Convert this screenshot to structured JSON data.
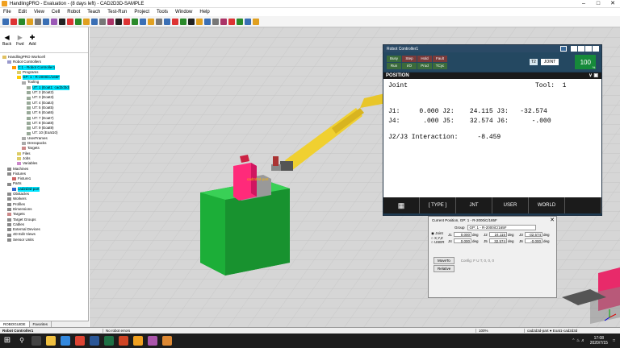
{
  "window": {
    "title": "HandlingPRO - Evaluation - (8 days left) - CAD2D3D-SAMPLE"
  },
  "menu": [
    "File",
    "Edit",
    "View",
    "Cell",
    "Robot",
    "Teach",
    "Test-Run",
    "Project",
    "Tools",
    "Window",
    "Help"
  ],
  "sidebar": {
    "back_label": "Back",
    "fwd_label": "Fwd",
    "add_label": "Add",
    "tree": [
      {
        "label": "HandlingPRO Workcell",
        "level": 0,
        "color": "#e0c060"
      },
      {
        "label": "Robot Controllers",
        "level": 1,
        "color": "#9999cc"
      },
      {
        "label": "C:1 - Robot Controller1",
        "level": 2,
        "color": "#ff9900",
        "selected": true
      },
      {
        "label": "Programs",
        "level": 3,
        "color": "#ddcc66"
      },
      {
        "label": "GP: 1 - R-2000iC/165F",
        "level": 3,
        "color": "#ffcc00",
        "selected": true
      },
      {
        "label": "Tooling",
        "level": 4,
        "color": "#aaaaaa"
      },
      {
        "label": "UT: 1 (Eoat1: cad2d3d)",
        "level": 5,
        "color": "#99aa99",
        "selected": true
      },
      {
        "label": "UT: 2  (Eoat2)",
        "level": 5,
        "color": "#99aa99"
      },
      {
        "label": "UT: 3  (Eoat3)",
        "level": 5,
        "color": "#99aa99"
      },
      {
        "label": "UT: 4  (Eoat4)",
        "level": 5,
        "color": "#99aa99"
      },
      {
        "label": "UT: 5  (Eoat5)",
        "level": 5,
        "color": "#99aa99"
      },
      {
        "label": "UT: 6  (Eoat6)",
        "level": 5,
        "color": "#99aa99"
      },
      {
        "label": "UT: 7  (Eoat7)",
        "level": 5,
        "color": "#99aa99"
      },
      {
        "label": "UT: 8  (Eoat8)",
        "level": 5,
        "color": "#99aa99"
      },
      {
        "label": "UT: 9  (Eoat9)",
        "level": 5,
        "color": "#99aa99"
      },
      {
        "label": "UT: 10  (Eoat10)",
        "level": 5,
        "color": "#99aa99"
      },
      {
        "label": "UserFrames",
        "level": 4,
        "color": "#aaaaaa"
      },
      {
        "label": "Dresspacks",
        "level": 4,
        "color": "#aaaaaa"
      },
      {
        "label": "Targets",
        "level": 4,
        "color": "#cc8888"
      },
      {
        "label": "Files",
        "level": 3,
        "color": "#ddcc66"
      },
      {
        "label": "Jobs",
        "level": 3,
        "color": "#ddcc66"
      },
      {
        "label": "Variables",
        "level": 3,
        "color": "#cc88cc"
      },
      {
        "label": "Machines",
        "level": 1,
        "color": "#888888"
      },
      {
        "label": "Fixtures",
        "level": 1,
        "color": "#888888"
      },
      {
        "label": "Fixture1",
        "level": 2,
        "color": "#cc6666"
      },
      {
        "label": "Parts",
        "level": 1,
        "color": "#888888"
      },
      {
        "label": "cad2d3d-part",
        "level": 2,
        "color": "#3366cc",
        "selected": true
      },
      {
        "label": "Obstacles",
        "level": 1,
        "color": "#888888"
      },
      {
        "label": "Workers",
        "level": 1,
        "color": "#888888"
      },
      {
        "label": "Profiles",
        "level": 1,
        "color": "#888888"
      },
      {
        "label": "Dimensions",
        "level": 1,
        "color": "#888888"
      },
      {
        "label": "Targets",
        "level": 1,
        "color": "#cc8888"
      },
      {
        "label": "Target Groups",
        "level": 1,
        "color": "#888888"
      },
      {
        "label": "Cables",
        "level": 1,
        "color": "#888888"
      },
      {
        "label": "External Devices",
        "level": 1,
        "color": "#888888"
      },
      {
        "label": "4D Edit Views",
        "level": 1,
        "color": "#888888"
      },
      {
        "label": "Sensor Units",
        "level": 1,
        "color": "#888888"
      }
    ],
    "tabs": [
      "ROBOGUIDE",
      "Favorites"
    ]
  },
  "scene": {
    "part_label": "cad2d3d-part"
  },
  "teach_pendant": {
    "title": "Robot Controller1",
    "status": [
      {
        "label": "Busy",
        "color": "#3b6b3b"
      },
      {
        "label": "Step",
        "color": "#7a3a3a"
      },
      {
        "label": "Hold",
        "color": "#7a3a3a"
      },
      {
        "label": "Fault",
        "color": "#7a3a3a"
      },
      {
        "label": "Run",
        "color": "#3b6b3b"
      },
      {
        "label": "I/O",
        "color": "#3b6b3b"
      },
      {
        "label": "Prod",
        "color": "#3b6b3b"
      },
      {
        "label": "TCyc",
        "color": "#3b6b3b"
      }
    ],
    "group": "T2",
    "mode": "JOINT",
    "override": "100",
    "override_unit": "%",
    "screen_header": "POSITION",
    "position_type": "Joint",
    "tool": "Tool:  1",
    "joint_lines": [
      "J1:     0.000 J2:    24.115 J3:   -32.574",
      "J4:      .000 J5:    32.574 J6:      -.000"
    ],
    "interaction": "J2/J3 Interaction:     -8.459",
    "softkeys": [
      "[ TYPE ]",
      "JNT",
      "USER",
      "WORLD"
    ]
  },
  "current_position": {
    "title": "Current Position, GP: 1 - R-2000iC/165F",
    "group_label": "Group",
    "group_value": "GP: 1 - R-2000iC/165F",
    "modes": [
      "Joint",
      "X,Y,Z",
      "USER"
    ],
    "joints": [
      {
        "name": "J1",
        "value": "0.000"
      },
      {
        "name": "J2",
        "value": "24.115"
      },
      {
        "name": "J3",
        "value": "-32.574"
      },
      {
        "name": "J4",
        "value": "0.000"
      },
      {
        "name": "J5",
        "value": "32.574"
      },
      {
        "name": "J6",
        "value": "-0.000"
      }
    ],
    "unit": "deg",
    "move_to": "MoveTo",
    "relative": "Relative",
    "config": "Config: F U T, 0, 0, 0"
  },
  "status_bar": {
    "left": "Robot Controller1",
    "middle": "No robot errors",
    "zoom": "100%",
    "right": "cad2d3d-part ● Eoat1-cad2d3d"
  },
  "clock": {
    "time": "17:08",
    "date": "2020/7/15"
  }
}
